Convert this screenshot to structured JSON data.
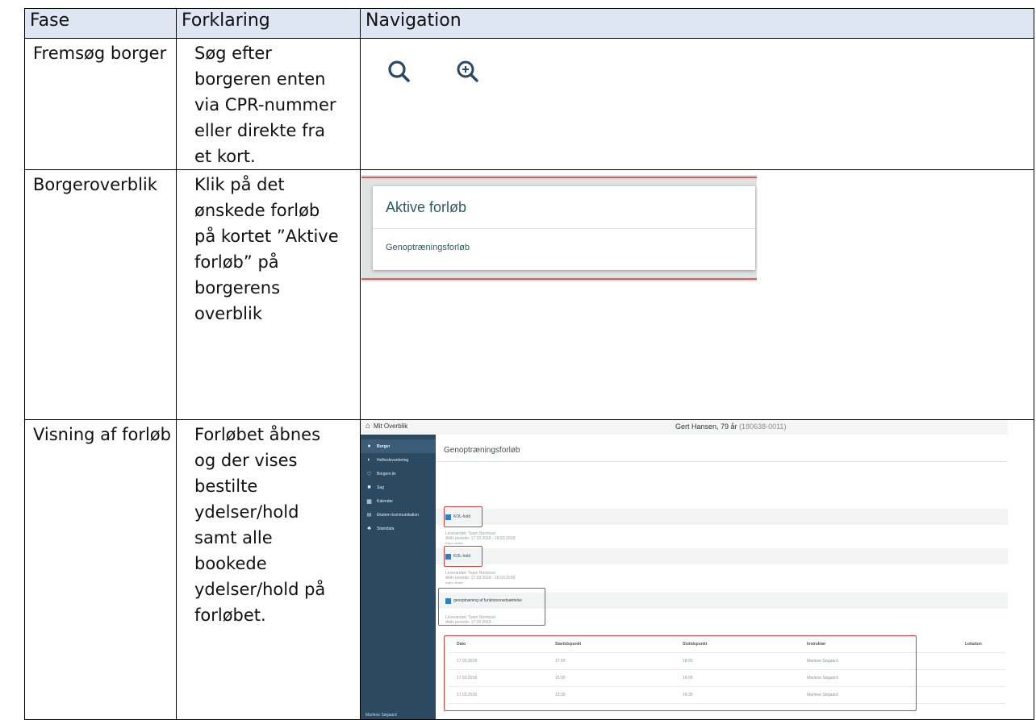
{
  "table": {
    "headers": [
      "Fase",
      "Forklaring",
      "Navigation"
    ],
    "rows": [
      {
        "fase": "Fremsøg borger",
        "forklaring": [
          "Søg efter",
          "borgeren enten",
          "via CPR-nummer",
          "eller direkte fra",
          "et kort."
        ],
        "icons": [
          "search-icon",
          "zoom-in-icon"
        ]
      },
      {
        "fase": "Borgeroverblik",
        "forklaring": [
          "Klik på det",
          "ønskede forløb",
          "på kortet ”Aktive",
          "forløb” på",
          "borgerens",
          "overblik"
        ]
      },
      {
        "fase": "Visning af forløb",
        "forklaring": [
          "Forløbet åbnes",
          "og der vises",
          "bestilte",
          "ydelser/hold",
          "samt alle",
          "bookede",
          "ydelser/hold på",
          "forløbet."
        ]
      }
    ]
  },
  "aktive_card": {
    "title": "Aktive forløb",
    "item": "Genoptræningsforløb"
  },
  "app": {
    "home_label": "Mit Overblik",
    "patient_name": "Gert Hansen, 79 år",
    "patient_id": "(180638-0011)",
    "sidebar": [
      {
        "icon": "person-icon",
        "glyph": "●",
        "label": "Borger",
        "active": true
      },
      {
        "icon": "refresh-icon",
        "glyph": "◐",
        "label": "Helhedsvurdering"
      },
      {
        "icon": "heart-icon",
        "glyph": "♡",
        "label": "Borgers liv"
      },
      {
        "icon": "folder-icon",
        "glyph": "■",
        "label": "Sag"
      },
      {
        "icon": "calendar-icon",
        "glyph": "▦",
        "label": "Kalender"
      },
      {
        "icon": "mail-icon",
        "glyph": "✉",
        "label": "Ekstern kommunikation"
      },
      {
        "icon": "user-data-icon",
        "glyph": "♣",
        "label": "Stamdata"
      }
    ],
    "sidebar_user": "Marlene Søgaard",
    "main_title": "Genoptræningsforløb",
    "holds": [
      {
        "label": "KOL-hold",
        "supplier": "Leverandør: Team Nordvest",
        "period": "Aktiv periode: 17.03.2018 - 18.03.2018",
        "note": "Ingen aftaler"
      },
      {
        "label": "KOL-hold",
        "supplier": "Leverandør: Team Nordvest",
        "period": "Aktiv periode: 17.03.2018 - 18.03.2018",
        "note": "Ingen aftaler"
      },
      {
        "label": "genoptræning af funktionsnedsættelse",
        "supplier": "Leverandør: Team Nordvest",
        "period": "Aktiv periode: 17.03.2018 - ",
        "note": ""
      }
    ],
    "schedule": {
      "headers": [
        "Dato",
        "Startidspunkt",
        "Slutidspunkt",
        "Instruktør",
        "Lokation"
      ],
      "rows": [
        [
          "17.03.2018",
          "17:00",
          "18:00",
          "Marlene Søgaard",
          ""
        ],
        [
          "17.03.2018",
          "15:00",
          "16:00",
          "Marlene Søgaard",
          ""
        ],
        [
          "17.03.2018",
          "13:30",
          "14:30",
          "Marlene Søgaard",
          ""
        ]
      ]
    }
  }
}
